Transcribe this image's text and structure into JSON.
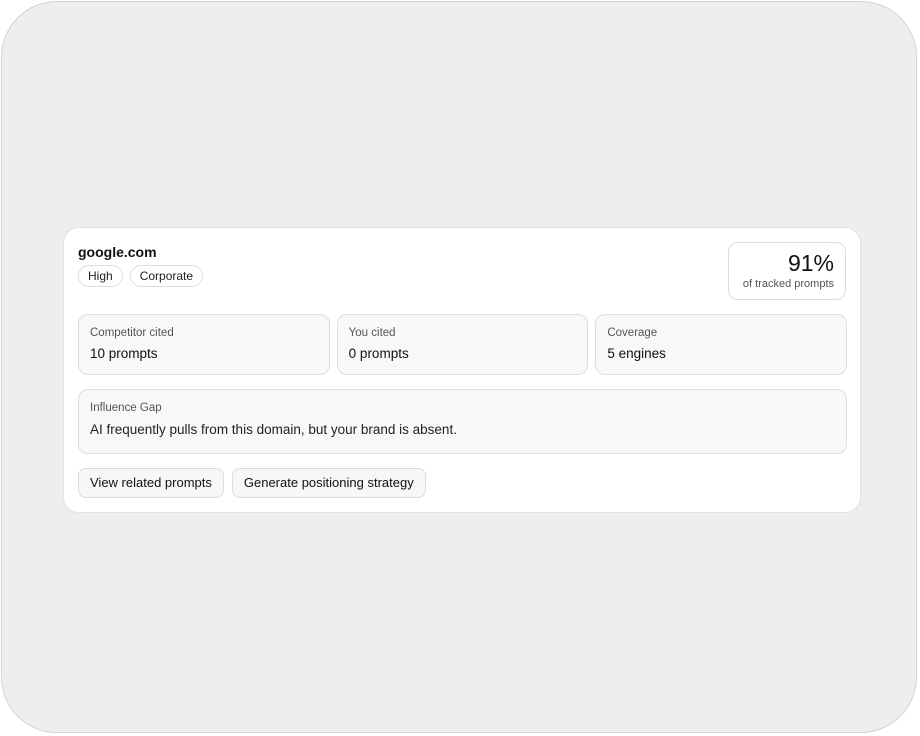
{
  "competitor": {
    "domain": "google.com",
    "tags": [
      "High",
      "Corporate"
    ]
  },
  "score": {
    "value": "91%",
    "caption": "of tracked prompts"
  },
  "stats": [
    {
      "label": "Competitor cited",
      "value": "10 prompts"
    },
    {
      "label": "You cited",
      "value": "0 prompts"
    },
    {
      "label": "Coverage",
      "value": "5 engines"
    }
  ],
  "influence_gap": {
    "title": "Influence Gap",
    "text": "AI frequently pulls from this domain, but your brand is absent."
  },
  "actions": {
    "view_related": "View related prompts",
    "generate_strategy": "Generate positioning strategy"
  }
}
